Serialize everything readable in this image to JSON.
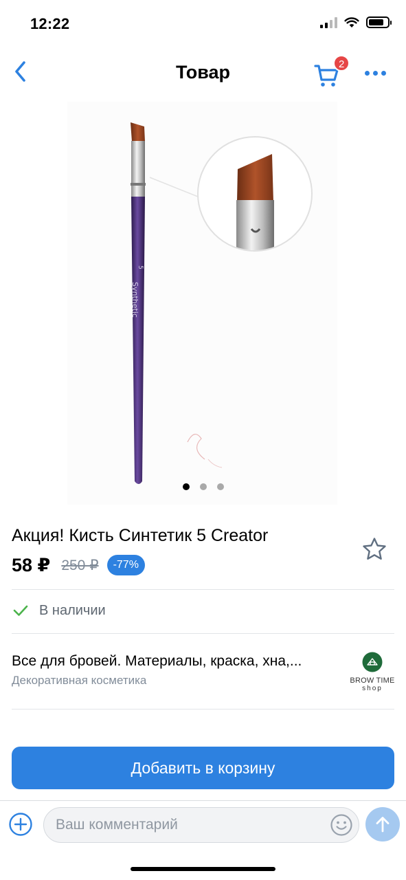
{
  "status_bar": {
    "time": "12:22"
  },
  "nav": {
    "title": "Товар",
    "cart_count": "2"
  },
  "product": {
    "title": "Акция! Кисть Синтетик 5 Creator",
    "price": "58 ₽",
    "old_price": "250 ₽",
    "discount": "-77%",
    "brush_number": "5",
    "brush_label": "Synthetic",
    "image_count": 3,
    "active_image": 0
  },
  "availability": {
    "text": "В наличии"
  },
  "shop": {
    "name": "Все для бровей. Материалы, краска, хна,...",
    "category": "Декоративная косметика",
    "logo_line1": "BROW TIME",
    "logo_line2": "shop"
  },
  "actions": {
    "add_to_cart": "Добавить в корзину"
  },
  "composer": {
    "placeholder": "Ваш комментарий"
  },
  "colors": {
    "accent": "#2d81e0",
    "badge": "#e64646",
    "success": "#4bb34b",
    "brush_handle": "#4a2f78",
    "shop_logo": "#1f6b3a"
  }
}
